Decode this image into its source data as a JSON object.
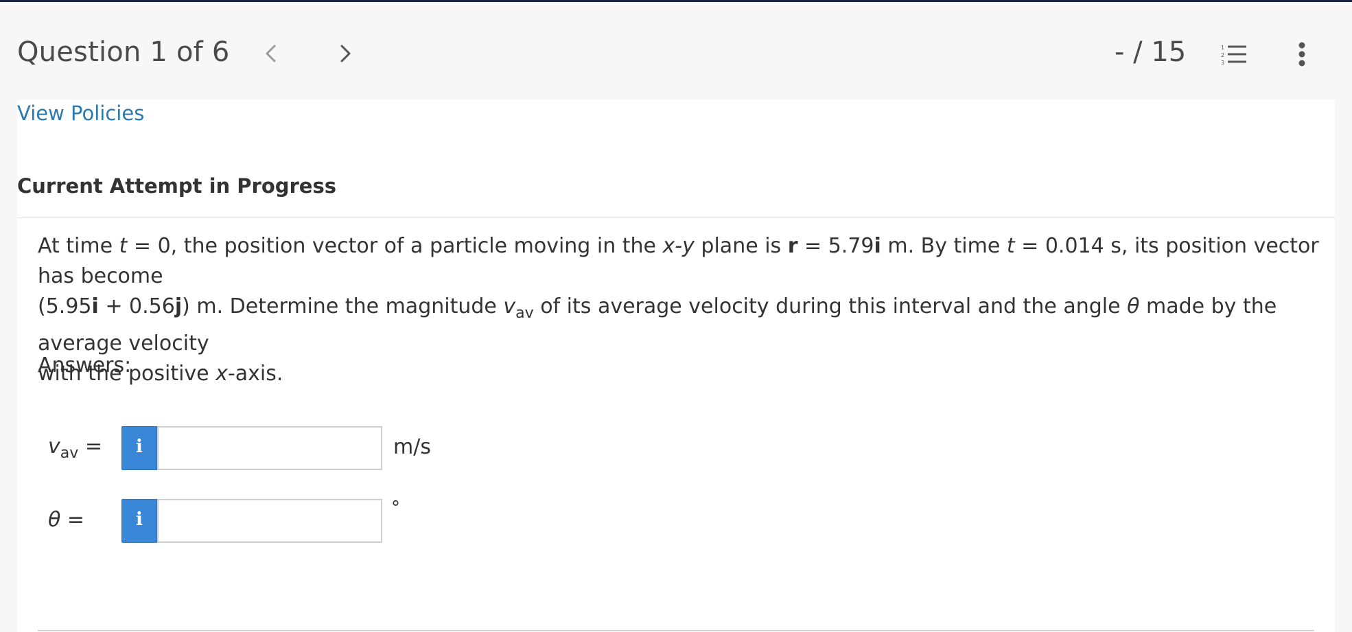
{
  "header": {
    "question_title": "Question 1 of 6",
    "score": "- / 15",
    "icons": {
      "prev": "chevron-left-icon",
      "next": "chevron-right-icon",
      "list": "numbered-list-icon",
      "more": "more-vertical-icon"
    }
  },
  "policies_link": "View Policies",
  "attempt_heading": "Current Attempt in Progress",
  "question": {
    "l1_a": "At time ",
    "l1_t": "t",
    "l1_b": " = 0, the position vector of a particle moving in the ",
    "l1_xy": "x-y",
    "l1_c": " plane is ",
    "l1_r": "r",
    "l1_d": " = 5.79",
    "l1_i": "i",
    "l1_e": " m. By time ",
    "l1_t2": "t",
    "l1_f": " = 0.014 s, its position vector has become",
    "l2_a": "(5.95",
    "l2_i": "i",
    "l2_b": " + 0.56",
    "l2_j": "j",
    "l2_c": ") m. Determine the magnitude ",
    "l2_v": "v",
    "l2_sub": "av",
    "l2_d": " of its average velocity during this interval and the angle ",
    "l2_theta": "θ",
    "l2_e": " made by the average velocity",
    "l3_a": "with the positive ",
    "l3_x": "x",
    "l3_b": "-axis."
  },
  "answers_label": "Answers:",
  "answers": [
    {
      "label_var": "v",
      "label_sub": "av",
      "label_eq": " =",
      "info": "i",
      "value": "",
      "unit": "m/s"
    },
    {
      "label_var": "θ",
      "label_sub": "",
      "label_eq": " =",
      "info": "i",
      "value": "",
      "unit": "°"
    }
  ],
  "colors": {
    "link": "#2a7ab0",
    "info_button": "#3a87d8",
    "top_bar": "#1b2540"
  }
}
